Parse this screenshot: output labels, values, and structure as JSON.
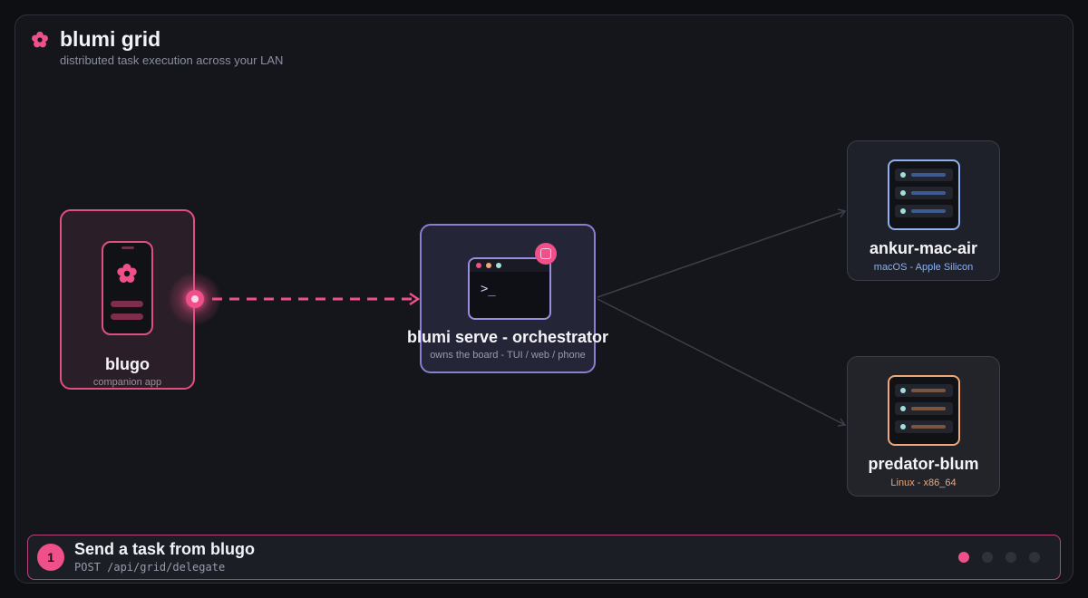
{
  "app": {
    "title": "blumi grid",
    "subtitle": "distributed task execution across your LAN"
  },
  "nodes": {
    "blugo": {
      "name": "blugo",
      "desc": "companion app",
      "color": "#e0507e"
    },
    "orchestrator": {
      "name": "blumi serve - orchestrator",
      "desc": "owns the board - TUI / web / phone",
      "prompt": ">_",
      "color": "#8a7ed0"
    },
    "hosts": [
      {
        "name": "ankur-mac-air",
        "desc": "macOS - Apple Silicon",
        "color": "#8fb0f0"
      },
      {
        "name": "predator-blum",
        "desc": "Linux - x86_64",
        "color": "#f0a878"
      }
    ]
  },
  "step": {
    "number": "1",
    "title": "Send a task from blugo",
    "endpoint": "POST /api/grid/delegate",
    "current": 1,
    "total": 4
  },
  "icons": {
    "brand": "flower-icon",
    "phone": "phone-icon",
    "terminal": "terminal-icon",
    "server": "server-rack-icon"
  },
  "colors": {
    "accent": "#f0508a",
    "background": "#14161c"
  }
}
